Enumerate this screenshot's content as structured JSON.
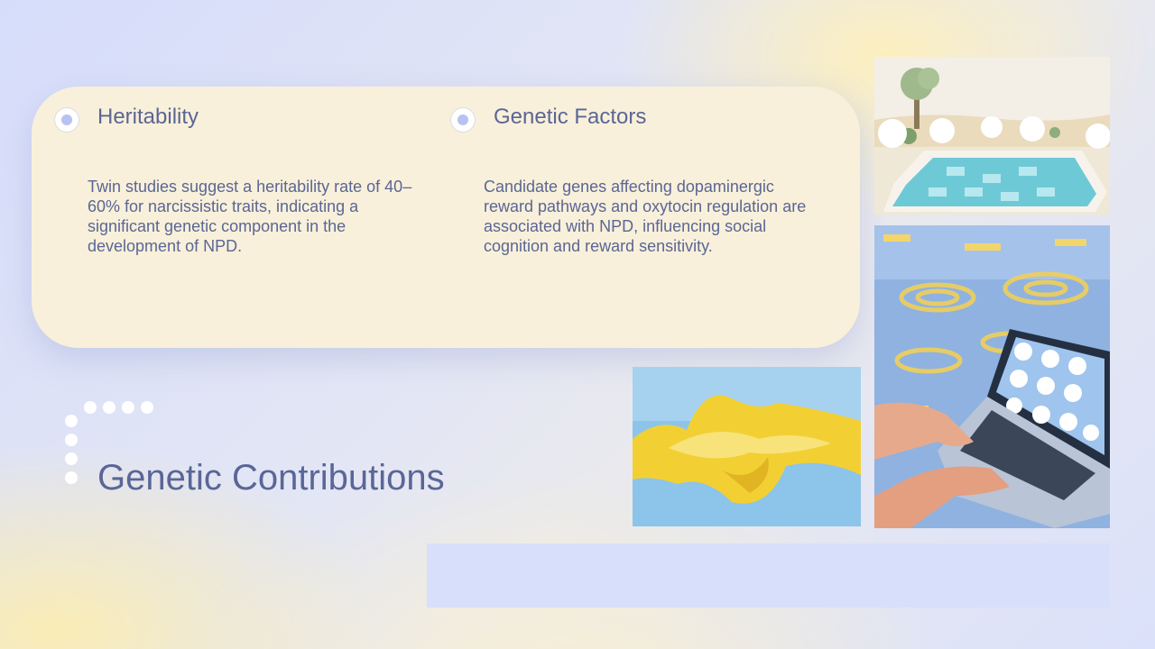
{
  "slide": {
    "title": "Genetic Contributions",
    "colors": {
      "card": "#f8f0da",
      "text": "#5b6695",
      "marker": "#b6c2f2",
      "band": "#d7dffa"
    }
  },
  "sections": [
    {
      "heading": "Heritability",
      "body": "Twin studies suggest a heritability rate of 40–60% for narcissistic traits, indicating a significant genetic component in the development of NPD."
    },
    {
      "heading": "Genetic Factors",
      "body": "Candidate genes affecting dopaminergic reward pathways and oxytocin regulation are associated with NPD, influencing social cognition and reward sensitivity."
    }
  ],
  "images": [
    "pool-painting",
    "laptop-water-painting",
    "yellow-abstract-painting"
  ]
}
